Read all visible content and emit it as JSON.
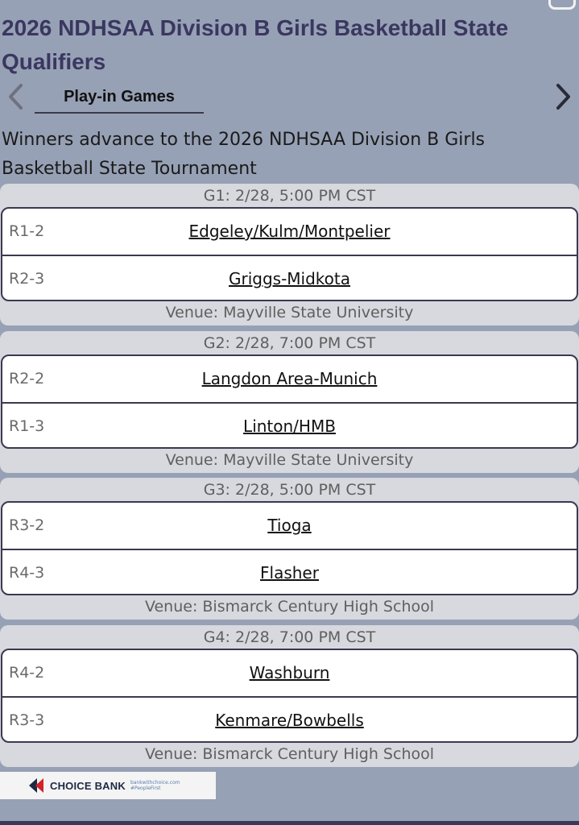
{
  "page": {
    "title": "2026 NDHSAA Division B Girls Basketball State Qualifiers",
    "tab_label": "Play-in Games",
    "subtitle": "Winners advance to the 2026 NDHSAA Division B Girls Basketball State Tournament"
  },
  "games": [
    {
      "header": "G1: 2/28, 5:00 PM CST",
      "teams": [
        {
          "seed": "R1-2",
          "name": "Edgeley/Kulm/Montpelier"
        },
        {
          "seed": "R2-3",
          "name": "Griggs-Midkota"
        }
      ],
      "venue": "Venue: Mayville State University"
    },
    {
      "header": "G2: 2/28, 7:00 PM CST",
      "teams": [
        {
          "seed": "R2-2",
          "name": "Langdon Area-Munich"
        },
        {
          "seed": "R1-3",
          "name": "Linton/HMB"
        }
      ],
      "venue": "Venue: Mayville State University"
    },
    {
      "header": "G3: 2/28, 5:00 PM CST",
      "teams": [
        {
          "seed": "R3-2",
          "name": "Tioga"
        },
        {
          "seed": "R4-3",
          "name": "Flasher"
        }
      ],
      "venue": "Venue: Bismarck Century High School"
    },
    {
      "header": "G4: 2/28, 7:00 PM CST",
      "teams": [
        {
          "seed": "R4-2",
          "name": "Washburn"
        },
        {
          "seed": "R3-3",
          "name": "Kenmare/Bowbells"
        }
      ],
      "venue": "Venue: Bismarck Century High School"
    }
  ],
  "sponsor": {
    "name": "CHOICE BANK",
    "line1": "bankwithchoice.com",
    "line2": "#PeopleFirst"
  },
  "icons": {
    "prev": "chevron-left-icon",
    "next": "chevron-right-icon"
  },
  "colors": {
    "background": "#97a1b5",
    "title": "#3a3760",
    "card": "#d7d9de",
    "card_border": "#3b3950"
  }
}
